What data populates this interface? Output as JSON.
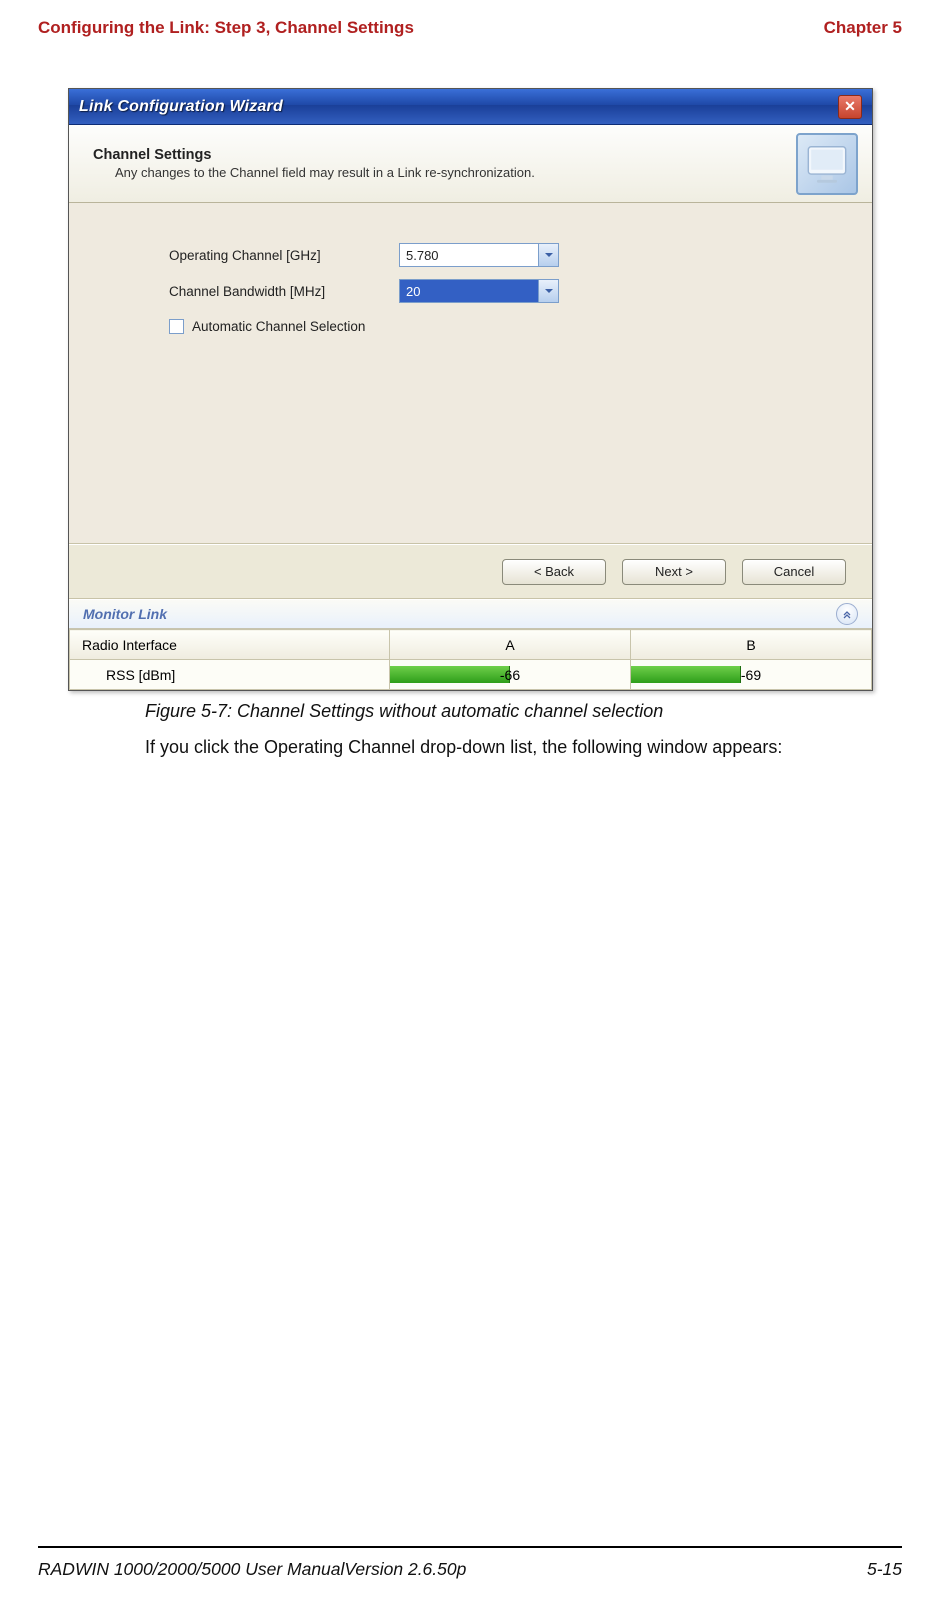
{
  "header": {
    "left": "Configuring the Link: Step 3, Channel Settings",
    "right": "Chapter 5"
  },
  "wizard": {
    "title": "Link Configuration Wizard",
    "panel_title": "Channel Settings",
    "panel_subtitle": "Any changes to the Channel field may result in a Link re-synchronization.",
    "fields": {
      "op_channel_label": "Operating Channel [GHz]",
      "op_channel_value": "5.780",
      "bandwidth_label": "Channel Bandwidth [MHz]",
      "bandwidth_value": "20",
      "acs_label": "Automatic Channel Selection"
    },
    "buttons": {
      "back": "< Back",
      "next": "Next >",
      "cancel": "Cancel"
    },
    "monitor": {
      "title": "Monitor Link",
      "row1": "Radio Interface",
      "colA": "A",
      "colB": "B",
      "row2": "RSS [dBm]",
      "valA": "-66",
      "valB": "-69"
    }
  },
  "caption": "Figure 5-7: Channel Settings without automatic channel selection",
  "body_copy": "If you click the Operating Channel drop-down list, the following window appears:",
  "footer": {
    "left": "RADWIN 1000/2000/5000 User ManualVersion  2.6.50p",
    "right": "5-15"
  }
}
